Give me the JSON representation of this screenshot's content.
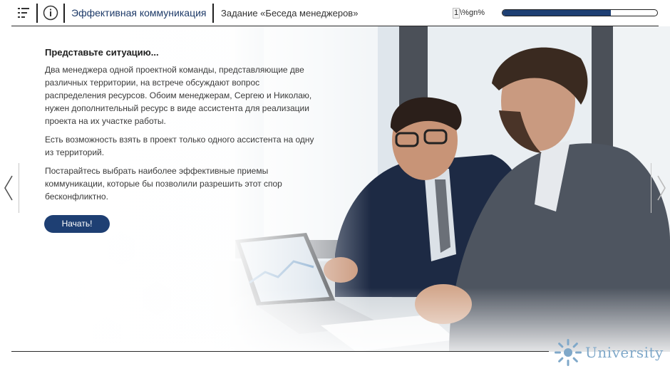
{
  "header": {
    "course_title": "Эффективная коммуникация",
    "task_title": "Задание «Беседа менеджеров»",
    "page_current": "1",
    "page_suffix": "\\%gn%",
    "progress_fraction": 0.7
  },
  "icons": {
    "menu": "menu-list-icon",
    "info": "info-icon",
    "prev": "chevron-left-icon",
    "next": "chevron-right-icon"
  },
  "content": {
    "heading": "Представьте ситуацию...",
    "paragraphs": [
      "Два менеджера одной проектной команды, представляющие две различных территории, на встрече обсуждают вопрос распределения ресурсов. Обоим менеджерам, Сергею и Николаю, нужен дополнительный ресурс в виде ассистента для реализации проекта на их участке работы.",
      "Есть возможность взять в проект только одного ассистента на одну из территорий.",
      "Постарайтесь выбрать наиболее эффективные приемы коммуникации, которые бы позволили разрешить этот спор бесконфликтно."
    ],
    "start_button": "Начать!"
  },
  "logo": {
    "word": "University"
  },
  "colors": {
    "accent": "#1e3f73",
    "title_text": "#1d3a68",
    "logo": "#7fa8c9"
  }
}
